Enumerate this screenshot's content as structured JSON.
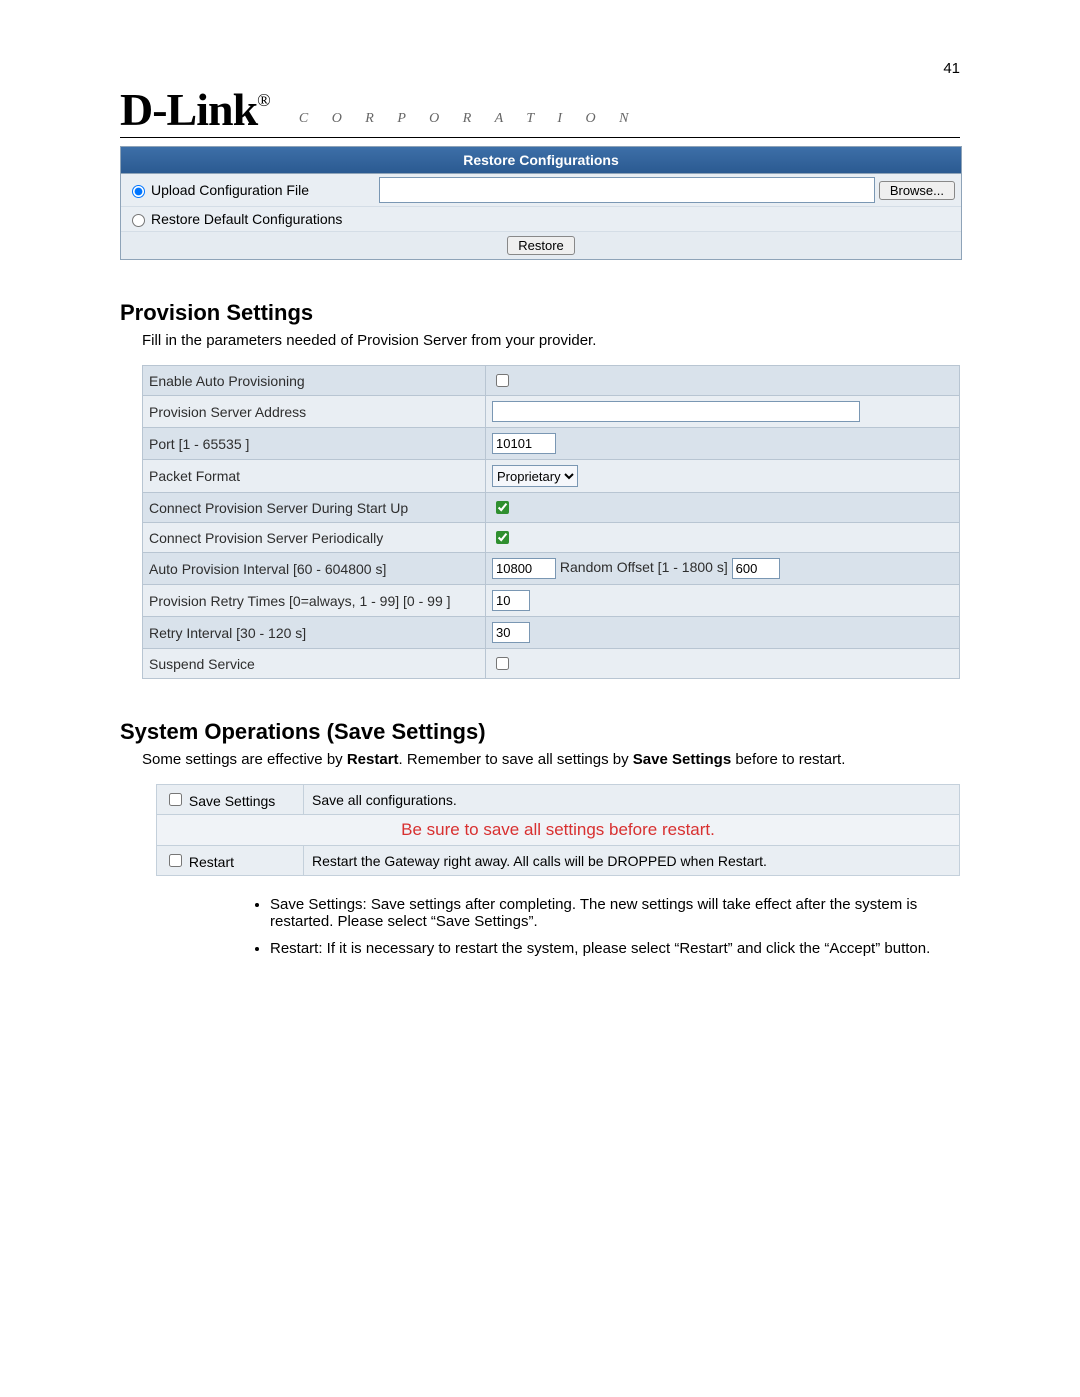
{
  "page_number": "41",
  "logo": {
    "brand": "D-Link",
    "reg": "®",
    "sub": "C  O  R  P  O  R  A  T  I  O  N"
  },
  "restore": {
    "header": "Restore Configurations",
    "upload_label": "Upload Configuration File",
    "default_label": "Restore Default Configurations",
    "browse_btn": "Browse...",
    "restore_btn": "Restore",
    "file_value": ""
  },
  "provision": {
    "heading": "Provision Settings",
    "desc": "Fill in the parameters needed of Provision Server from your provider.",
    "rows": {
      "enable_label": "Enable Auto Provisioning",
      "server_label": "Provision Server Address",
      "server_value": "",
      "port_label": "Port [1 - 65535 ]",
      "port_value": "10101",
      "packet_label": "Packet Format",
      "packet_value": "Proprietary",
      "startup_label": "Connect Provision Server During Start Up",
      "periodic_label": "Connect Provision Server Periodically",
      "interval_label": "Auto Provision Interval [60 - 604800 s]",
      "interval_value": "10800",
      "rand_label": "Random Offset [1 - 1800 s]",
      "rand_value": "600",
      "retry_label": "Provision Retry Times [0=always, 1 - 99] [0 - 99 ]",
      "retry_value": "10",
      "retry_int_label": "Retry Interval [30 - 120 s]",
      "retry_int_value": "30",
      "suspend_label": "Suspend Service"
    }
  },
  "sysops": {
    "heading": "System Operations (Save Settings)",
    "desc_pre": "Some settings are effective by ",
    "desc_b1": "Restart",
    "desc_mid": ". Remember to save all settings by ",
    "desc_b2": "Save Settings",
    "desc_post": " before to restart.",
    "save_label": "Save Settings",
    "save_desc": "Save all configurations.",
    "warning": "Be sure to save all settings before restart.",
    "restart_label": "Restart",
    "restart_desc": "Restart the Gateway right away. All calls will be DROPPED when Restart.",
    "bullet1": "Save Settings: Save settings after completing. The new settings will take effect after the system is restarted. Please select “Save Settings”.",
    "bullet2": "Restart: If it is necessary to restart the system, please select “Restart” and click the “Accept” button."
  }
}
